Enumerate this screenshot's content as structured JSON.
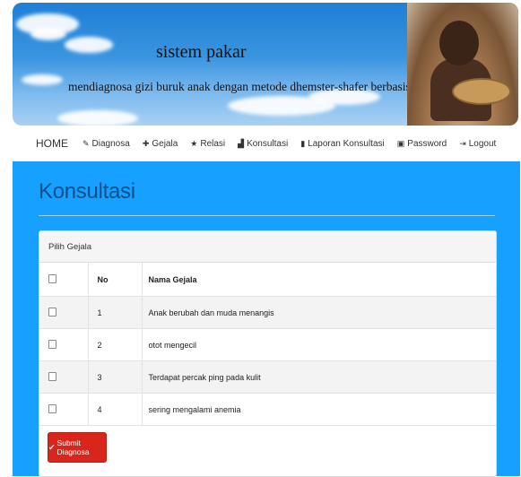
{
  "banner": {
    "title": "sistem pakar",
    "subtitle": "mendiagnosa gizi buruk anak dengan metode dhemster-shafer berbasis web"
  },
  "nav": {
    "home": "HOME",
    "items": [
      {
        "label": "Diagnosa",
        "icon": "wrench-icon"
      },
      {
        "label": "Gejala",
        "icon": "plus-icon"
      },
      {
        "label": "Relasi",
        "icon": "star-icon"
      },
      {
        "label": "Konsultasi",
        "icon": "bar-chart-icon"
      },
      {
        "label": "Laporan Konsultasi",
        "icon": "book-icon"
      },
      {
        "label": "Password",
        "icon": "lock-icon"
      },
      {
        "label": "Logout",
        "icon": "logout-icon"
      }
    ]
  },
  "page": {
    "title": "Konsultasi",
    "panel_heading": "Pilih Gejala",
    "columns": {
      "no": "No",
      "name": "Nama Gejala"
    },
    "rows": [
      {
        "no": "1",
        "name": "Anak berubah dan muda menangis"
      },
      {
        "no": "2",
        "name": "otot mengecil"
      },
      {
        "no": "3",
        "name": "Terdapat percak ping pada kulit"
      },
      {
        "no": "4",
        "name": "sering mengalami anemia"
      }
    ],
    "submit_label": "Submit Diagnosa"
  },
  "colors": {
    "main_bg": "#16a0ff",
    "title": "#0b4f8a",
    "submit": "#d9261c"
  }
}
